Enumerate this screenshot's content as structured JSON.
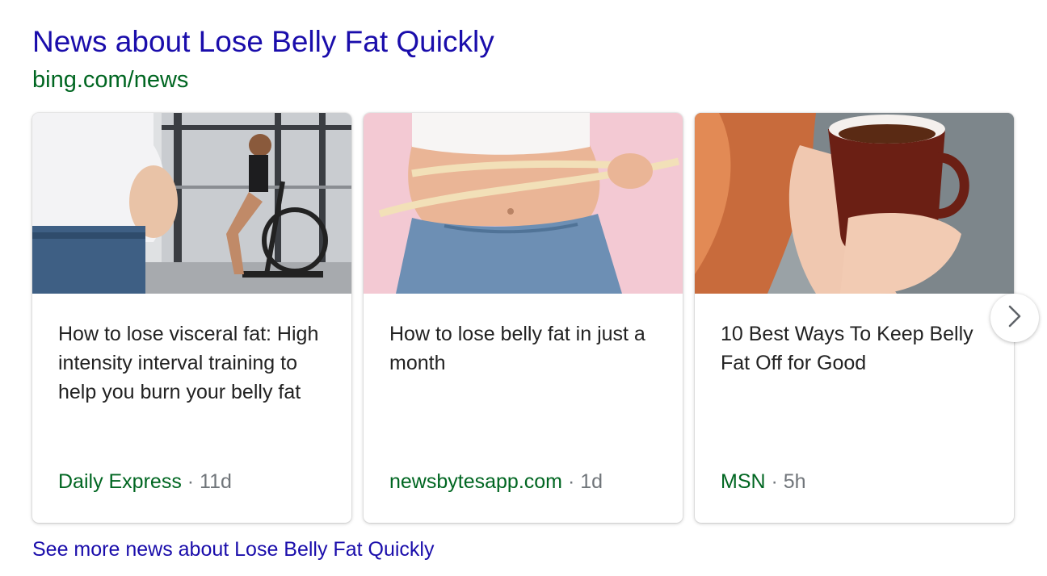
{
  "header": {
    "title": "News about Lose Belly Fat Quickly",
    "source": "bing.com/news"
  },
  "cards": [
    {
      "image": "man-holding-belly-and-woman-on-air-bike",
      "headline": "How to lose visceral fat: High intensity interval training to help you burn your belly fat",
      "source": "Daily Express",
      "separator": " · ",
      "age": "11d"
    },
    {
      "image": "tape-measure-around-waist",
      "headline": "How to lose belly fat in just a month",
      "source": "newsbytesapp.com",
      "separator": " · ",
      "age": "1d"
    },
    {
      "image": "hands-holding-mug-of-tea",
      "headline": "10 Best Ways To Keep Belly Fat Off for Good",
      "source": "MSN",
      "separator": " · ",
      "age": "5h"
    }
  ],
  "carousel": {
    "next_icon": "chevron-right-icon"
  },
  "footer": {
    "see_more": "See more news about Lose Belly Fat Quickly"
  },
  "colors": {
    "title": "#1a0dab",
    "source": "#006621",
    "meta": "#70757a",
    "headline": "#222222"
  }
}
